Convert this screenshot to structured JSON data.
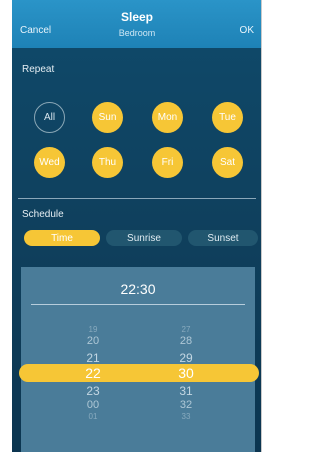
{
  "header": {
    "cancel": "Cancel",
    "title": "Sleep",
    "subtitle": "Bedroom",
    "ok": "OK"
  },
  "repeat": {
    "label": "Repeat",
    "days": [
      "All",
      "Sun",
      "Mon",
      "Tue",
      "Wed",
      "Thu",
      "Fri",
      "Sat"
    ],
    "selected": [
      "Sun",
      "Mon",
      "Tue",
      "Wed",
      "Thu",
      "Fri",
      "Sat"
    ]
  },
  "schedule": {
    "label": "Schedule",
    "options": [
      "Time",
      "Sunrise",
      "Sunset"
    ],
    "selected": "Time"
  },
  "picker": {
    "time": "22:30",
    "hours": [
      "19",
      "20",
      "21",
      "22",
      "23",
      "00",
      "01"
    ],
    "minutes": [
      "27",
      "28",
      "29",
      "30",
      "31",
      "32",
      "33"
    ],
    "selected_hour": "22",
    "selected_minute": "30"
  },
  "colors": {
    "accent": "#f6c636",
    "header": "#2a94c8",
    "background": "#0f4a6b",
    "picker": "#4a7c99"
  }
}
